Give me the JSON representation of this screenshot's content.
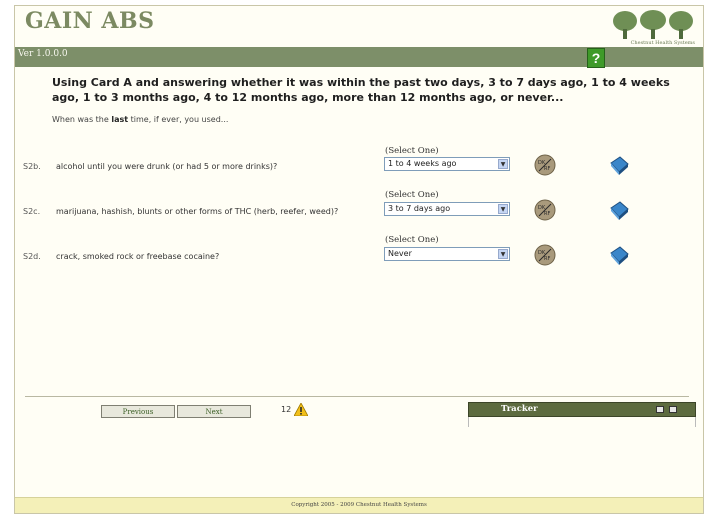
{
  "app": {
    "title": "GAIN ABS",
    "version": "Ver 1.0.0.0",
    "logo_text": "Chestnut Health Systems"
  },
  "help": {
    "label": "?"
  },
  "instructions": {
    "prompt": "Using Card A and answering whether it was within the past two days, 3 to 7 days ago, 1 to 4 weeks ago, 1 to 3 months ago, 4 to 12 months ago, more than 12 months ago, or never...",
    "sub_before": "When was the ",
    "sub_bold": "last",
    "sub_after": " time, if ever, you used..."
  },
  "questions": [
    {
      "code": "S2b.",
      "text": "alcohol until you were drunk (or had 5 or more drinks)?",
      "select_label": "(Select One)",
      "value": "1 to 4 weeks ago",
      "dk_icon": "dk-rf-icon",
      "book_icon": "book-icon"
    },
    {
      "code": "S2c.",
      "text": "marijuana, hashish, blunts or other forms of THC (herb, reefer, weed)?",
      "select_label": "(Select One)",
      "value": "3 to 7 days ago",
      "dk_icon": "dk-rf-icon",
      "book_icon": "book-icon"
    },
    {
      "code": "S2d.",
      "text": "crack, smoked rock or freebase cocaine?",
      "select_label": "(Select One)",
      "value": "Never",
      "dk_icon": "dk-rf-icon",
      "book_icon": "book-icon"
    }
  ],
  "nav": {
    "previous_label": "Previous",
    "next_label": "Next",
    "page_number": "12",
    "warning_icon": "warning-icon"
  },
  "tracker": {
    "label": "Tracker"
  },
  "footer": {
    "copyright": "Copyright 2005 - 2009 Chestnut Health Systems"
  },
  "colors": {
    "header_bar": "#7d8f69",
    "tracker_bar": "#5d6b3f",
    "footer_bar": "#f4f0b8",
    "title_text": "#7c8a62",
    "help_green": "#3f9a29"
  }
}
